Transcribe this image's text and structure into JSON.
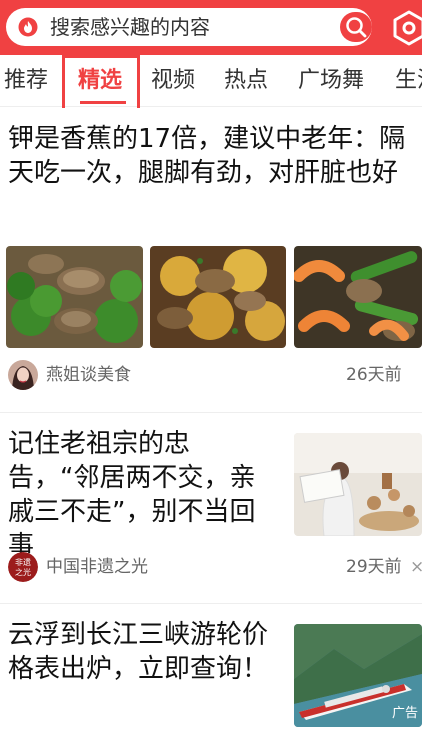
{
  "search": {
    "placeholder": "搜索感兴趣的内容"
  },
  "tabs": [
    {
      "label": "推荐"
    },
    {
      "label": "精选"
    },
    {
      "label": "视频"
    },
    {
      "label": "热点"
    },
    {
      "label": "广场舞"
    },
    {
      "label": "生活"
    }
  ],
  "articles": [
    {
      "title": "钾是香蕉的17倍，建议中老年：隔天吃一次，腿脚有劲，对肝脏也好",
      "source": "燕姐谈美食",
      "time": "26天前"
    },
    {
      "title": "记住老祖宗的忠告，“邻居两不交，亲戚三不走”，别不当回事",
      "source": "中国非遗之光",
      "avatar_text": "非遗\n之光",
      "time": "29天前",
      "dismiss": "×"
    },
    {
      "title": "云浮到长江三峡游轮价格表出炉，立即查询！",
      "ad_label": "广告"
    }
  ],
  "colors": {
    "brand": "#f04142"
  },
  "icons": {
    "search_logo": "flame-logo-icon",
    "search_button": "search-icon",
    "top_right": "hexagon-icon"
  }
}
